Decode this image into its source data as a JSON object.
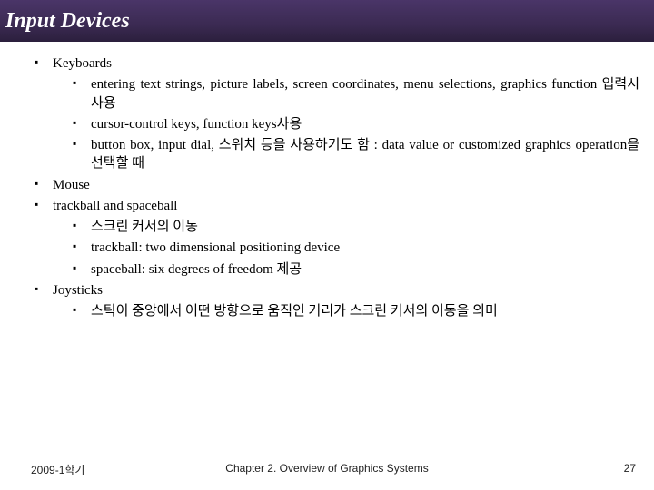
{
  "header": {
    "title": "Input Devices"
  },
  "bullets": {
    "keyboards": {
      "label": "Keyboards",
      "sub": [
        "entering text strings, picture labels, screen coordinates, menu selections, graphics function 입력시 사용",
        "cursor-control keys, function keys사용",
        "button box, input dial, 스위치 등을 사용하기도 함 : data value or customized graphics operation을 선택할 때"
      ]
    },
    "mouse": {
      "label": "Mouse"
    },
    "trackball": {
      "label": "trackball and spaceball",
      "sub": [
        "스크린 커서의 이동",
        "trackball: two dimensional positioning device",
        "spaceball: six degrees of freedom 제공"
      ]
    },
    "joysticks": {
      "label": "Joysticks",
      "sub": [
        "스틱이 중앙에서 어떤 방향으로 움직인 거리가 스크린 커서의 이동을 의미"
      ]
    }
  },
  "footer": {
    "left": "2009-1학기",
    "center": "Chapter 2. Overview of Graphics Systems",
    "page": "27"
  }
}
